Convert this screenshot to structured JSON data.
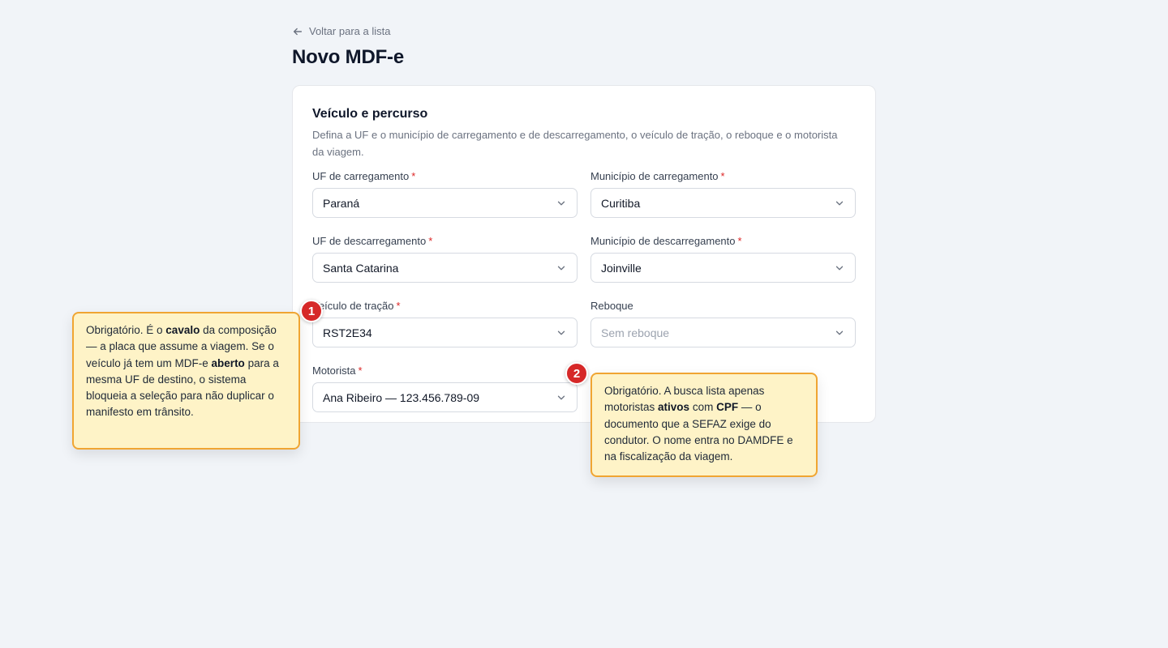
{
  "nav": {
    "back_label": "Voltar para a lista"
  },
  "page": {
    "title": "Novo MDF-e"
  },
  "card": {
    "title": "Veículo e percurso",
    "description": "Defina a UF e o município de carregamento e de descarregamento, o veículo de tração, o reboque e o motorista da viagem."
  },
  "fields": {
    "required_mark": "*",
    "uf_carregamento": {
      "label": "UF de carregamento",
      "value": "Paraná"
    },
    "municipio_carregamento": {
      "label": "Município de carregamento",
      "value": "Curitiba"
    },
    "uf_descarregamento": {
      "label": "UF de descarregamento",
      "value": "Santa Catarina"
    },
    "municipio_descarregamento": {
      "label": "Município de descarregamento",
      "value": "Joinville"
    },
    "veiculo_tracao": {
      "label": "Veículo de tração",
      "value": "RST2E34"
    },
    "reboque": {
      "label": "Reboque",
      "placeholder": "Sem reboque"
    },
    "motorista": {
      "label": "Motorista",
      "value": "Ana Ribeiro — 123.456.789-09"
    }
  },
  "tooltips": {
    "one": {
      "badge": "1",
      "t1": "Obrigatório. É o ",
      "b1": "cavalo",
      "t2": " da composição — a placa que assume a viagem. Se o veículo já tem um MDF-e ",
      "b2": "aberto",
      "t3": " para a mesma UF de destino, o sistema bloqueia a seleção para não duplicar o manifesto em trânsito."
    },
    "two": {
      "badge": "2",
      "t1": "Obrigatório. A busca lista apenas motoristas ",
      "b1": "ativos",
      "t2": " com ",
      "b2": "CPF",
      "t3": " — o documento que a SEFAZ exige do condutor. O nome entra no DAMDFE e na fiscalização da viagem."
    }
  },
  "colors": {
    "accent_required": "#dc2626",
    "badge": "#d62828",
    "tooltip_bg": "#fef3c7",
    "tooltip_border": "#f0a532",
    "page_bg": "#f1f4f8"
  },
  "icons": {
    "back": "arrow-left-icon",
    "select": "chevron-down-icon"
  }
}
